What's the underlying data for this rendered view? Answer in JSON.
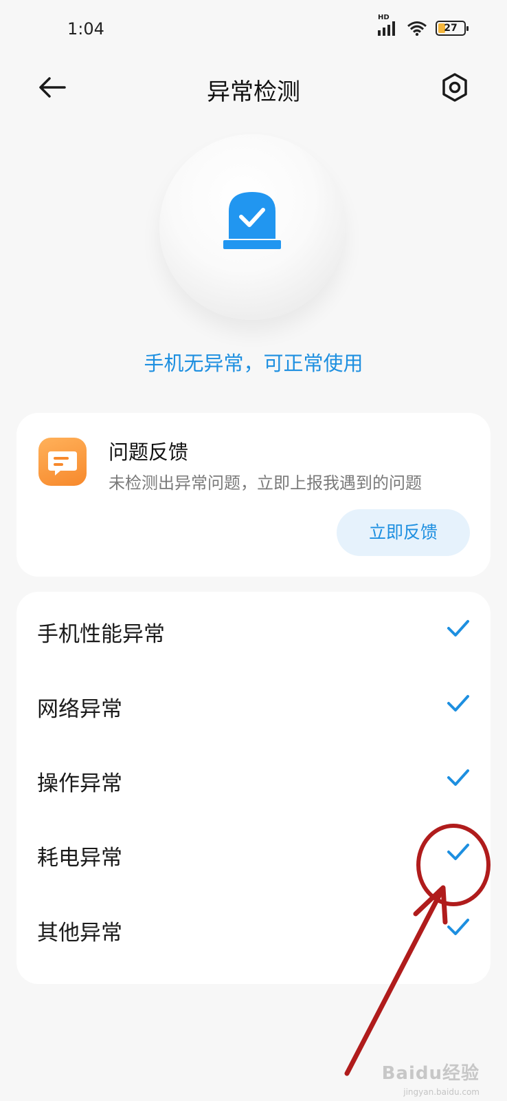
{
  "status_bar": {
    "time": "1:04",
    "network_label": "HD",
    "battery_level": "27",
    "battery_fraction": 0.27
  },
  "header": {
    "title": "异常检测",
    "back_icon": "arrow-left-icon",
    "settings_icon": "hexagon-gear-icon"
  },
  "status": {
    "message": "手机无异常，可正常使用",
    "icon": "alarm-check-icon"
  },
  "feedback_card": {
    "title": "问题反馈",
    "description": "未检测出异常问题，立即上报我遇到的问题",
    "button_label": "立即反馈",
    "icon": "chat-bubble-icon"
  },
  "checks": {
    "items": [
      {
        "label": "手机性能异常",
        "status": "ok"
      },
      {
        "label": "网络异常",
        "status": "ok"
      },
      {
        "label": "操作异常",
        "status": "ok"
      },
      {
        "label": "耗电异常",
        "status": "ok"
      },
      {
        "label": "其他异常",
        "status": "ok"
      }
    ]
  },
  "watermark": {
    "text": "Baidu经验",
    "sub": "jingyan.baidu.com"
  },
  "colors": {
    "accent": "#1d8fe0",
    "orange": "#f7892c",
    "annotation": "#b01c1c"
  }
}
